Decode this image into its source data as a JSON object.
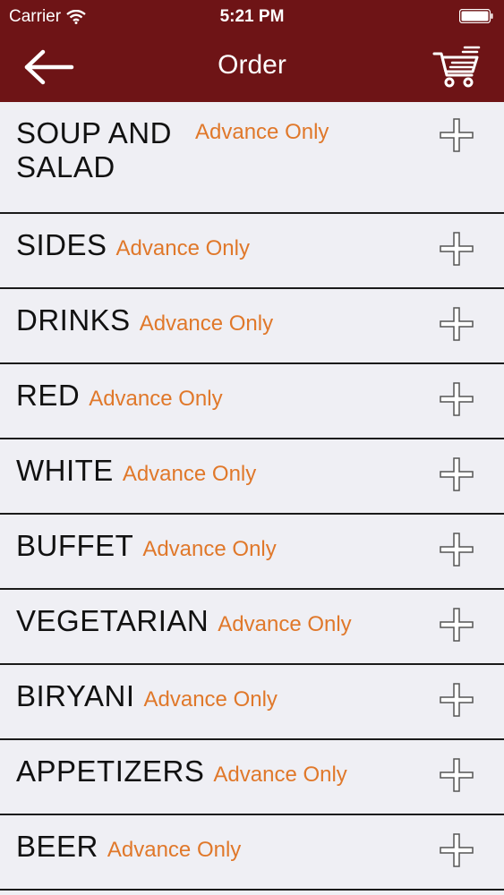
{
  "status_bar": {
    "carrier": "Carrier",
    "time": "5:21 PM"
  },
  "nav": {
    "title": "Order",
    "back_icon": "back-arrow-icon",
    "cart_icon": "shopping-cart-icon"
  },
  "colors": {
    "header_bg": "#6e1416",
    "badge": "#e0782a",
    "row_bg": "#efeff4"
  },
  "categories": [
    {
      "name": "SOUP AND SALAD",
      "badge": "Advance Only"
    },
    {
      "name": "SIDES",
      "badge": "Advance Only"
    },
    {
      "name": "DRINKS",
      "badge": "Advance Only"
    },
    {
      "name": "RED",
      "badge": "Advance Only"
    },
    {
      "name": "WHITE",
      "badge": "Advance Only"
    },
    {
      "name": "BUFFET",
      "badge": "Advance Only"
    },
    {
      "name": "VEGETARIAN",
      "badge": "Advance Only"
    },
    {
      "name": "BIRYANI",
      "badge": "Advance Only"
    },
    {
      "name": "APPETIZERS",
      "badge": "Advance Only"
    },
    {
      "name": "BEER",
      "badge": "Advance Only"
    }
  ]
}
